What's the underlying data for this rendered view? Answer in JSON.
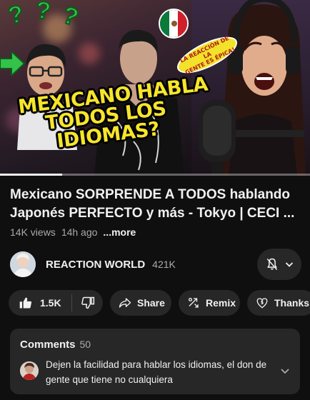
{
  "video": {
    "thumbnail_headline": [
      "MEXICANO HABLA",
      "TODOS LOS",
      "IDIOMAS?"
    ],
    "thumbnail_badge": [
      "LA REACCIÓN DE LA",
      "GENTE ES ÉPICA!"
    ],
    "thumbnail_question_mark": "?",
    "progress_fraction": 0.2
  },
  "title": {
    "line1": "Mexicano SORPRENDE A TODOS hablando",
    "line2": "Japonés PERFECTO y más - Tokyo | CECI ..."
  },
  "meta": {
    "views": "14K views",
    "age": "14h ago",
    "more_label": "...more"
  },
  "channel": {
    "name": "REACTION WORLD",
    "subscribers": "421K"
  },
  "actions": {
    "like_count": "1.5K",
    "share_label": "Share",
    "remix_label": "Remix",
    "thanks_label": "Thanks"
  },
  "comments": {
    "heading": "Comments",
    "count": "50",
    "top_comment": "Dejen la facilidad para hablar los idiomas, el don de gente que tiene no cualquiera"
  },
  "colors": {
    "background": "#0f0f0f",
    "surface": "#272727",
    "text_primary": "#f1f1f1",
    "text_secondary": "#aaaaaa",
    "thumbnail_headline": "#f6e52a"
  },
  "icons": {
    "like": "thumbs-up-icon",
    "dislike": "thumbs-down-icon",
    "share": "share-arrow-icon",
    "remix": "remix-icon",
    "thanks": "thanks-dollar-icon",
    "notifications": "bell-off-icon",
    "expand": "chevron-down-icon"
  }
}
